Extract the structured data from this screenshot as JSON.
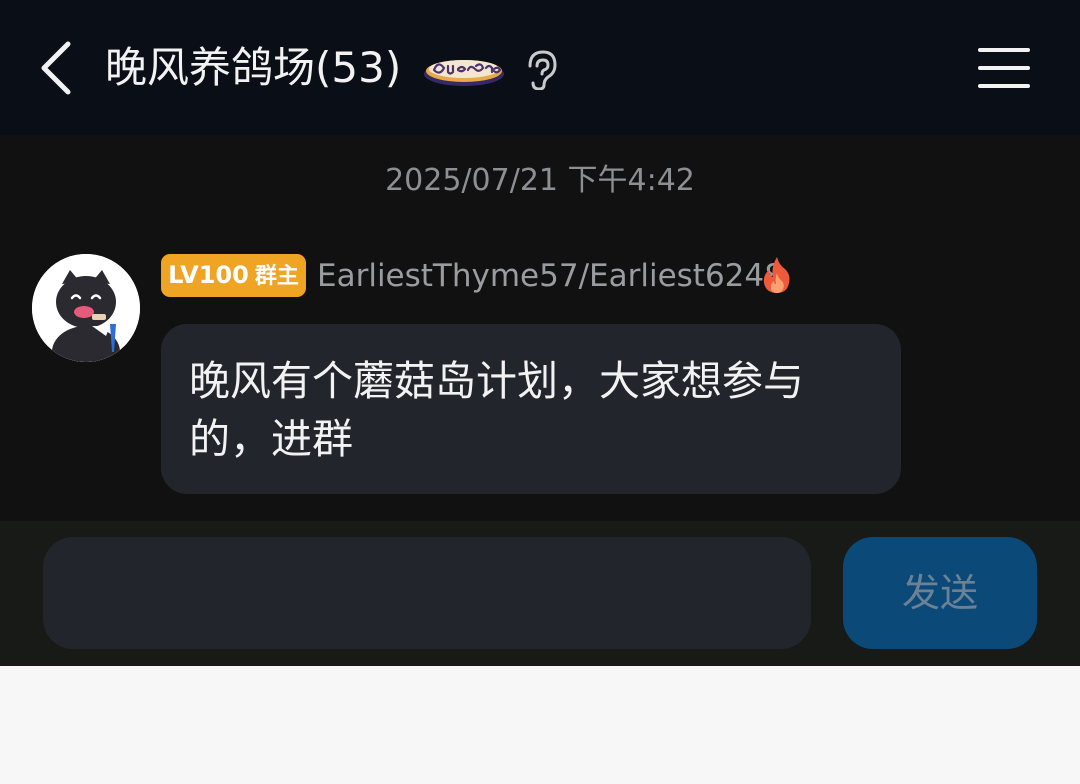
{
  "header": {
    "title": "晚风养鸽场(53)",
    "emblem_text": "Que sera",
    "back_icon": "chevron-left-icon",
    "ear_icon": "ear-icon",
    "menu_icon": "hamburger-menu-icon"
  },
  "chat": {
    "timestamp": "2025/07/21 下午4:42",
    "message": {
      "badge_level": "LV100",
      "badge_role": "群主",
      "sender": "EarliestThyme57/Earliest6248",
      "status_icon": "fire-icon",
      "text": "晚风有个蘑菇岛计划，大家想参与的，进群"
    }
  },
  "composer": {
    "input_value": "",
    "send_label": "发送"
  },
  "colors": {
    "header_bg": "#0a0e16",
    "chat_bg": "#111111",
    "bubble_bg": "#22252b",
    "badge_bg": "#f0a424",
    "send_bg": "#0b4a78"
  }
}
